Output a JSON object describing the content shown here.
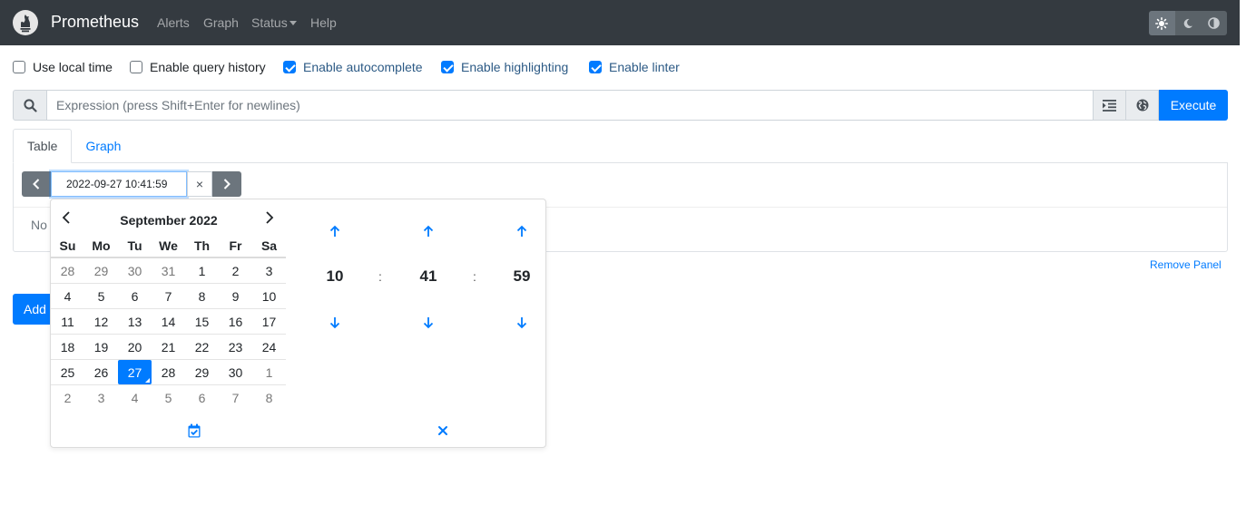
{
  "navbar": {
    "brand": "Prometheus",
    "links": [
      "Alerts",
      "Graph",
      "Status",
      "Help"
    ],
    "theme_icons": [
      "sun-icon",
      "moon-icon",
      "contrast-icon"
    ]
  },
  "options": [
    {
      "label": "Use local time",
      "checked": false
    },
    {
      "label": "Enable query history",
      "checked": false
    },
    {
      "label": "Enable autocomplete",
      "checked": true
    },
    {
      "label": "Enable highlighting",
      "checked": true
    },
    {
      "label": "Enable linter",
      "checked": true
    }
  ],
  "expression": {
    "placeholder": "Expression (press Shift+Enter for newlines)",
    "value": "",
    "execute_label": "Execute"
  },
  "tabs": [
    {
      "label": "Table",
      "active": true
    },
    {
      "label": "Graph",
      "active": false
    }
  ],
  "time_input": {
    "value": "2022-09-27 10:41:59",
    "clear": "×"
  },
  "panel": {
    "no_data": "No",
    "remove_label": "Remove Panel",
    "add_label": "Add"
  },
  "picker": {
    "month_title": "September 2022",
    "weekdays": [
      "Su",
      "Mo",
      "Tu",
      "We",
      "Th",
      "Fr",
      "Sa"
    ],
    "weeks": [
      [
        "28",
        "29",
        "30",
        "31",
        "1",
        "2",
        "3"
      ],
      [
        "4",
        "5",
        "6",
        "7",
        "8",
        "9",
        "10"
      ],
      [
        "11",
        "12",
        "13",
        "14",
        "15",
        "16",
        "17"
      ],
      [
        "18",
        "19",
        "20",
        "21",
        "22",
        "23",
        "24"
      ],
      [
        "25",
        "26",
        "27",
        "28",
        "29",
        "30",
        "1"
      ],
      [
        "2",
        "3",
        "4",
        "5",
        "6",
        "7",
        "8"
      ]
    ],
    "selected_day": "27",
    "time": {
      "hours": "10",
      "minutes": "41",
      "seconds": "59",
      "separator": ":"
    }
  }
}
